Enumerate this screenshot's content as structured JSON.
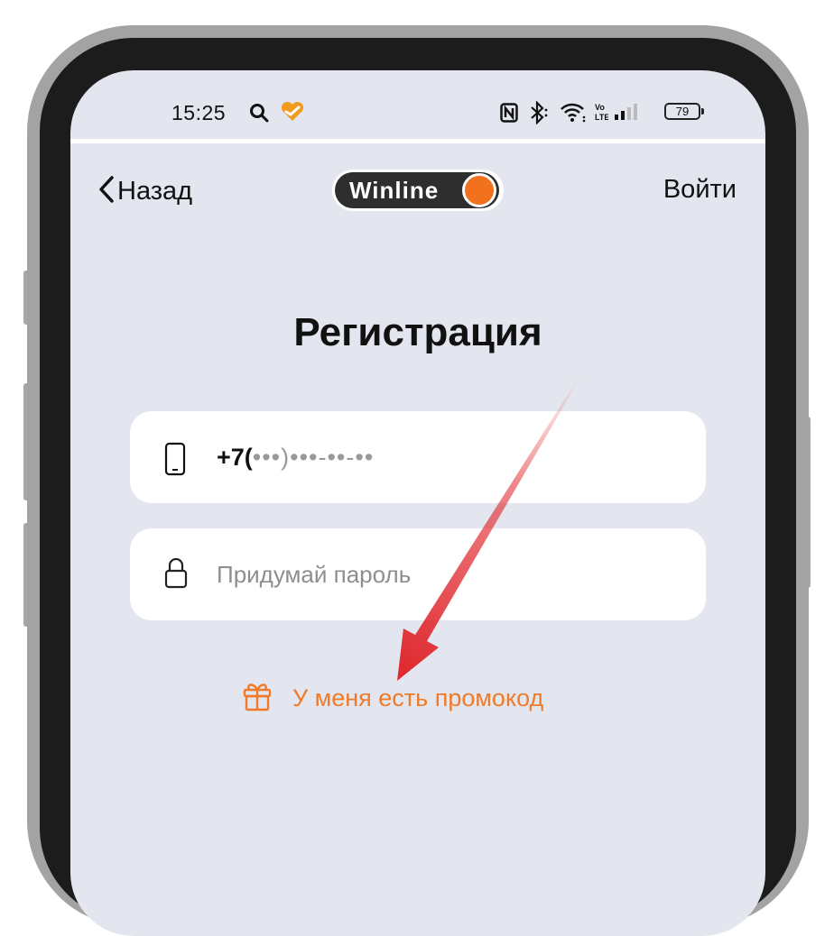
{
  "status_bar": {
    "time": "15:25",
    "battery": "79"
  },
  "nav": {
    "back_label": "Назад",
    "logo_text": "Winline",
    "login_label": "Войти"
  },
  "page": {
    "title": "Регистрация"
  },
  "form": {
    "phone_prefix": "+7(",
    "phone_mask": "•••)•••-••-••",
    "password_placeholder": "Придумай пароль"
  },
  "promo": {
    "label": "У меня есть промокод"
  },
  "colors": {
    "accent": "#ef7b2a",
    "logo_orange": "#f2711c",
    "screen_bg": "#e3e6ee",
    "annotation_arrow": "#e0262b"
  },
  "icons": {
    "search": "search-icon",
    "app_notification": "heart-check-icon",
    "nfc": "nfc-icon",
    "bluetooth": "bluetooth-icon",
    "wifi": "wifi-icon",
    "volte": "volte-icon",
    "signal": "signal-icon",
    "back": "chevron-left-icon",
    "phone": "smartphone-icon",
    "lock": "lock-icon",
    "gift": "gift-icon"
  }
}
